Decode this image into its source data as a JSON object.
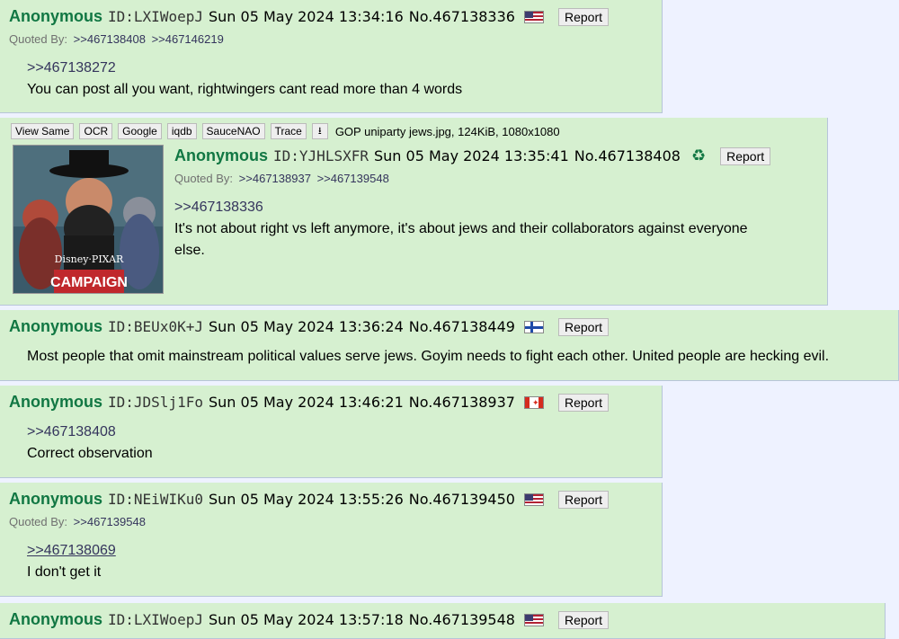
{
  "posts": [
    {
      "name": "Anonymous",
      "id": "ID:LXIWoepJ",
      "datetime": "Sun 05 May 2024 13:34:16",
      "no": "No.467138336",
      "report": "Report",
      "quoted_by_label": "Quoted By:",
      "quoted": [
        ">>467138408",
        ">>467146219"
      ],
      "quote": ">>467138272",
      "text": "You can post all you want, rightwingers cant read more than 4 words"
    },
    {
      "file_buttons": [
        "View Same",
        "OCR",
        "Google",
        "iqdb",
        "SauceNAO",
        "Trace"
      ],
      "file_text": "GOP uniparty jews.jpg, 124KiB, 1080x1080",
      "thumb_texts": [
        "Disney·PIXAR",
        "CAMPAIGN"
      ],
      "name": "Anonymous",
      "id": "ID:YJHLSXFR",
      "datetime": "Sun 05 May 2024 13:35:41",
      "no": "No.467138408",
      "report": "Report",
      "quoted_by_label": "Quoted By:",
      "quoted": [
        ">>467138937",
        ">>467139548"
      ],
      "quote": ">>467138336",
      "text1": "It's not about right vs left anymore, it's about jews and their collaborators against everyone",
      "text2": "else."
    },
    {
      "name": "Anonymous",
      "id": "ID:BEUx0K+J",
      "datetime": "Sun 05 May 2024 13:36:24",
      "no": "No.467138449",
      "report": "Report",
      "text": "Most people that omit mainstream political values serve jews. Goyim needs to fight each other. United people are hecking evil."
    },
    {
      "name": "Anonymous",
      "id": "ID:JDSlj1Fo",
      "datetime": "Sun 05 May 2024 13:46:21",
      "no": "No.467138937",
      "report": "Report",
      "quote": ">>467138408",
      "text": "Correct observation"
    },
    {
      "name": "Anonymous",
      "id": "ID:NEiWIKu0",
      "datetime": "Sun 05 May 2024 13:55:26",
      "no": "No.467139450",
      "report": "Report",
      "quoted_by_label": "Quoted By:",
      "quoted": [
        ">>467139548"
      ],
      "quote": ">>467138069",
      "text": "I don't get it"
    },
    {
      "name": "Anonymous",
      "id": "ID:LXIWoepJ",
      "datetime": "Sun 05 May 2024 13:57:18",
      "no": "No.467139548",
      "report": "Report"
    }
  ],
  "colors": {
    "post_bg": "#d6f0d0",
    "name": "#117743",
    "link": "#34345c",
    "page_bg": "#eef2ff"
  },
  "flags": [
    "us-flag-icon",
    "us-flag-icon",
    "finland-flag-icon",
    "canada-flag-icon",
    "us-flag-icon",
    "us-flag-icon"
  ]
}
